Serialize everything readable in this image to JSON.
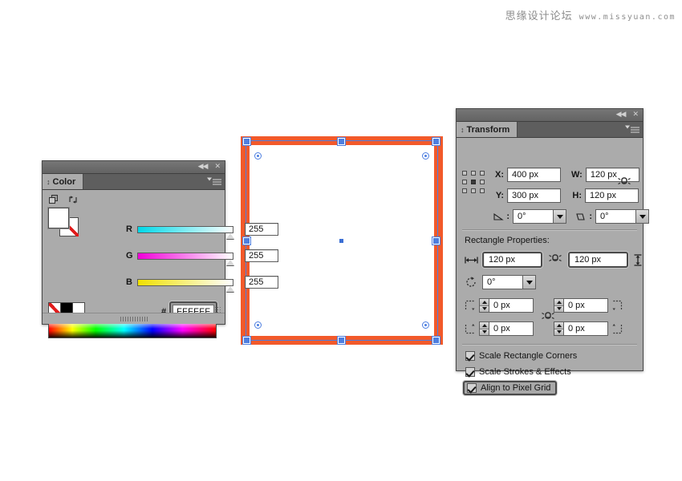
{
  "watermark": {
    "chinese": "思缘设计论坛",
    "url": "www.missyuan.com"
  },
  "color_panel": {
    "tab_label": "Color",
    "collapse_icon": "◀◀",
    "close_icon": "✕",
    "menu_icon": "panel-menu-icon",
    "fill_swatch_color": "#FFFFFF",
    "stroke_swatch_value": "None",
    "channels": [
      {
        "label": "R",
        "value": "255",
        "slider_from": "#00d8e8",
        "slider_to": "#ffffff",
        "position_pct": 100
      },
      {
        "label": "G",
        "value": "255",
        "slider_from": "#f000d8",
        "slider_to": "#ffffff",
        "position_pct": 100
      },
      {
        "label": "B",
        "value": "255",
        "slider_from": "#f0e000",
        "slider_to": "#ffffff",
        "position_pct": 100
      }
    ],
    "hex_symbol": "#",
    "hex_value": "FFFFFF",
    "swatches": [
      "none",
      "black",
      "white"
    ]
  },
  "transform_panel": {
    "tab_label": "Transform",
    "collapse_icon": "◀◀",
    "close_icon": "✕",
    "reference_point": "center",
    "fields": {
      "x_label": "X:",
      "x_value": "400 px",
      "y_label": "Y:",
      "y_value": "300 px",
      "w_label": "W:",
      "w_value": "120 px",
      "h_label": "H:",
      "h_value": "120 px",
      "rotate_label": "⊿:",
      "rotate_value": "0°",
      "shear_label": "⧄:",
      "shear_value": "0°"
    },
    "rectangle_properties": {
      "heading": "Rectangle Properties:",
      "width_value": "120 px",
      "height_value": "120 px",
      "rotation_value": "0°",
      "corner_radii": [
        {
          "corner": "top-left",
          "value": "0 px"
        },
        {
          "corner": "top-right",
          "value": "0 px"
        },
        {
          "corner": "bottom-left",
          "value": "0 px"
        },
        {
          "corner": "bottom-right",
          "value": "0 px"
        }
      ]
    },
    "checkboxes": [
      {
        "label": "Scale Rectangle Corners",
        "checked": true,
        "highlighted": false
      },
      {
        "label": "Scale Strokes & Effects",
        "checked": true,
        "highlighted": false
      },
      {
        "label": "Align to Pixel Grid",
        "checked": true,
        "highlighted": true
      }
    ]
  },
  "canvas": {
    "shape_name": "rectangle",
    "fill_color": "#FFFFFF",
    "stroke_color": "#F2592A",
    "selection_color": "#4D7EE0"
  }
}
